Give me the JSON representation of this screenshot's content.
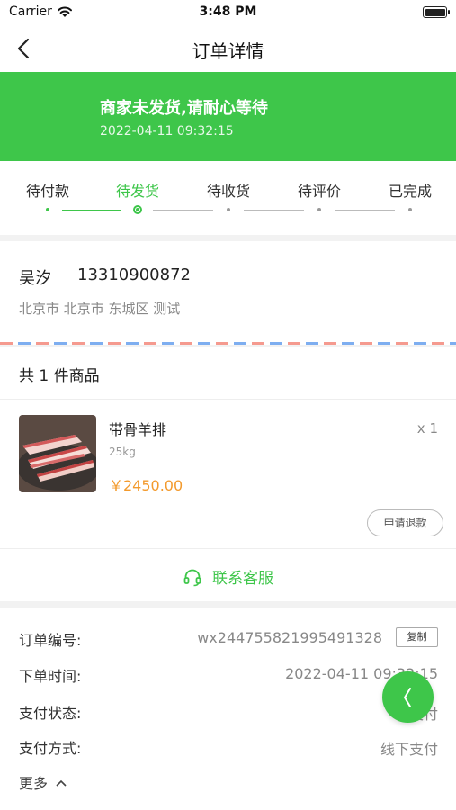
{
  "status_bar": {
    "carrier": "Carrier",
    "time": "3:48 PM"
  },
  "nav": {
    "title": "订单详情",
    "back_icon": "chevron-left-icon"
  },
  "banner": {
    "status_text": "商家未发货,请耐心等待",
    "datetime": "2022-04-11   09:32:15",
    "color": "#3ec64a"
  },
  "steps": {
    "items": [
      {
        "label": "待付款",
        "state": "done"
      },
      {
        "label": "待发货",
        "state": "current"
      },
      {
        "label": "待收货",
        "state": "pending"
      },
      {
        "label": "待评价",
        "state": "pending"
      },
      {
        "label": "已完成",
        "state": "pending"
      }
    ],
    "active_color": "#3ec64a"
  },
  "address": {
    "name": "吴汐",
    "phone": "13310900872",
    "detail": "北京市 北京市 东城区 测试"
  },
  "goods": {
    "count_text": "共 1 件商品",
    "items": [
      {
        "name": "带骨羊排",
        "spec": "25kg",
        "price": "￥2450.00",
        "qty": "x 1",
        "price_color": "#f39a2c"
      }
    ],
    "refund_label": "申请退款",
    "contact_label": "联系客服",
    "contact_icon": "headset-icon"
  },
  "order_info": {
    "rows": [
      {
        "label": "订单编号:",
        "value": "wx244755821995491328"
      },
      {
        "label": "下单时间:",
        "value": "2022-04-11 09:32:15"
      },
      {
        "label": "支付状态:",
        "value": "已支付"
      },
      {
        "label": "支付方式:",
        "value": "线下支付"
      }
    ],
    "copy_label": "复制",
    "more_label": "更多"
  },
  "float_button": {
    "icon": "chevron-left-icon"
  }
}
